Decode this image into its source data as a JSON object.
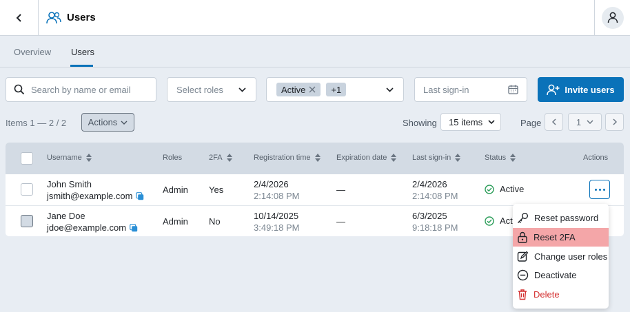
{
  "header": {
    "title": "Users"
  },
  "tabs": [
    {
      "label": "Overview"
    },
    {
      "label": "Users"
    }
  ],
  "filters": {
    "search_placeholder": "Search by name or email",
    "roles_placeholder": "Select roles",
    "status_chip": "Active",
    "status_more": "+1",
    "last_signin_placeholder": "Last sign-in",
    "invite_label": "Invite users"
  },
  "toolbar": {
    "items_count": "Items 1 — 2 / 2",
    "actions_label": "Actions",
    "showing_label": "Showing",
    "showing_value": "15 items",
    "page_label": "Page",
    "page_value": "1"
  },
  "table": {
    "columns": [
      "Username",
      "Roles",
      "2FA",
      "Registration time",
      "Expiration date",
      "Last sign-in",
      "Status",
      "Actions"
    ],
    "rows": [
      {
        "name": "John Smith",
        "email": "jsmith@example.com",
        "role": "Admin",
        "twofa": "Yes",
        "reg_date": "2/4/2026",
        "reg_time": "2:14:08 PM",
        "expiration": "—",
        "signin_date": "2/4/2026",
        "signin_time": "2:14:08 PM",
        "status": "Active"
      },
      {
        "name": "Jane Doe",
        "email": "jdoe@example.com",
        "role": "Admin",
        "twofa": "No",
        "reg_date": "10/14/2025",
        "reg_time": "3:49:18 PM",
        "expiration": "—",
        "signin_date": "6/3/2025",
        "signin_time": "9:18:18 PM",
        "status": "Act"
      }
    ]
  },
  "menu": {
    "items": [
      {
        "label": "Reset password",
        "icon": "key-icon"
      },
      {
        "label": "Reset 2FA",
        "icon": "lock-icon"
      },
      {
        "label": "Change user roles",
        "icon": "edit-icon"
      },
      {
        "label": "Deactivate",
        "icon": "minus-circle-icon"
      },
      {
        "label": "Delete",
        "icon": "trash-icon"
      }
    ]
  },
  "colors": {
    "primary": "#0a72b9",
    "success": "#2e9e5b",
    "danger": "#d32f2f",
    "highlight": "#f4a6a8"
  }
}
